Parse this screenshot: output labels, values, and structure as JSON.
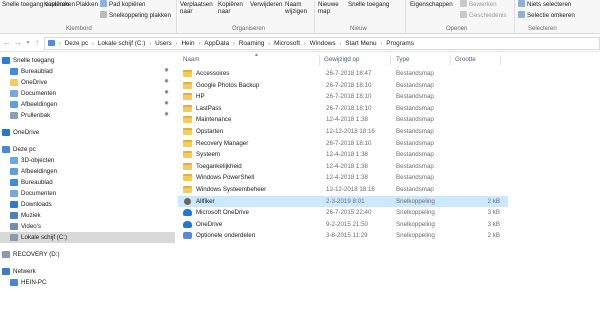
{
  "ribbon": {
    "copy_path": "Snelle toegang vastmaken",
    "copy": "Kopiëren",
    "paste": "Plakken",
    "cut": "Knippen",
    "copy_path_label": "Pad kopiëren",
    "paste_shortcut": "Snelkoppeling plakken",
    "move_to": "Verplaatsen naar",
    "copy_to": "Kopiëren naar",
    "delete": "Verwijderen",
    "rename": "Naam wijzigen",
    "new_folder": "Nieuwe map",
    "easy_access": "Snelle toegang",
    "properties": "Eigenschappen",
    "edit": "Bewerken",
    "history": "Geschiedenis",
    "select_none": "Niets selecteren",
    "invert_selection": "Selectie omkeren",
    "groups": {
      "clipboard": "Klembord",
      "organize": "Organiseren",
      "new": "Nieuw",
      "open": "Openen",
      "select": "Selecteren"
    }
  },
  "address": {
    "crumbs": [
      "Deze pc",
      "Lokale schijf (C:)",
      "Users",
      "Hein",
      "AppData",
      "Roaming",
      "Microsoft",
      "Windows",
      "Start Menu",
      "Programs"
    ]
  },
  "navpane": {
    "items": [
      {
        "label": "Snelle toegang",
        "icon": "star-icon",
        "pinned": false
      },
      {
        "label": "Bureaublad",
        "icon": "desktop-icon",
        "pinned": true
      },
      {
        "label": "OneDrive",
        "icon": "folder-icon",
        "pinned": true
      },
      {
        "label": "Documenten",
        "icon": "documents-icon",
        "pinned": true
      },
      {
        "label": "Afbeeldingen",
        "icon": "pictures-icon",
        "pinned": true
      },
      {
        "label": "Prullenbak",
        "icon": "recycle-bin-icon",
        "pinned": true
      },
      {
        "label": "OneDrive",
        "icon": "cloud-icon",
        "pinned": false
      },
      {
        "label": "Deze pc",
        "icon": "computer-icon",
        "pinned": false
      },
      {
        "label": "3D-objecten",
        "icon": "cube-icon",
        "pinned": false
      },
      {
        "label": "Afbeeldingen",
        "icon": "pictures-icon",
        "pinned": false
      },
      {
        "label": "Bureaublad",
        "icon": "desktop-icon",
        "pinned": false
      },
      {
        "label": "Documenten",
        "icon": "documents-icon",
        "pinned": false
      },
      {
        "label": "Downloads",
        "icon": "download-icon",
        "pinned": false
      },
      {
        "label": "Muziek",
        "icon": "music-icon",
        "pinned": false
      },
      {
        "label": "Video's",
        "icon": "video-icon",
        "pinned": false
      },
      {
        "label": "Lokale schijf (C:)",
        "icon": "drive-icon",
        "pinned": false
      },
      {
        "label": "RECOVERY (D:)",
        "icon": "drive-icon",
        "pinned": false
      },
      {
        "label": "Netwerk",
        "icon": "network-icon",
        "pinned": false
      },
      {
        "label": "HEIN-PC",
        "icon": "computer-icon",
        "pinned": false
      }
    ]
  },
  "columns": {
    "name": "Naam",
    "date": "Gewijzigd op",
    "type": "Type",
    "size": "Grootte"
  },
  "files": [
    {
      "name": "Accessoires",
      "date": "26-7-2018 18:47",
      "type": "Bestandsmap",
      "size": "",
      "kind": "folder"
    },
    {
      "name": "Google Photos Backup",
      "date": "26-7-2018 18:10",
      "type": "Bestandsmap",
      "size": "",
      "kind": "folder"
    },
    {
      "name": "HP",
      "date": "26-7-2018 18:10",
      "type": "Bestandsmap",
      "size": "",
      "kind": "folder"
    },
    {
      "name": "LastPass",
      "date": "26-7-2018 18:10",
      "type": "Bestandsmap",
      "size": "",
      "kind": "folder"
    },
    {
      "name": "Maintenance",
      "date": "12-4-2018 1:38",
      "type": "Bestandsmap",
      "size": "",
      "kind": "folder"
    },
    {
      "name": "Opstarten",
      "date": "12-12-2018 18:16",
      "type": "Bestandsmap",
      "size": "",
      "kind": "folder"
    },
    {
      "name": "Recovery Manager",
      "date": "26-7-2018 18:10",
      "type": "Bestandsmap",
      "size": "",
      "kind": "folder"
    },
    {
      "name": "Systeem",
      "date": "12-4-2018 1:38",
      "type": "Bestandsmap",
      "size": "",
      "kind": "folder"
    },
    {
      "name": "Toegankelijkheid",
      "date": "12-4-2018 1:38",
      "type": "Bestandsmap",
      "size": "",
      "kind": "folder"
    },
    {
      "name": "Windows PowerShell",
      "date": "12-4-2018 1:38",
      "type": "Bestandsmap",
      "size": "",
      "kind": "folder"
    },
    {
      "name": "Windows Systeembeheer",
      "date": "12-12-2018 18:16",
      "type": "Bestandsmap",
      "size": "",
      "kind": "folder"
    },
    {
      "name": "Allfiker",
      "date": "2-3-2019 8:01",
      "type": "Snelkoppeling",
      "size": "2 kB",
      "kind": "shortcut"
    },
    {
      "name": "Microsoft OneDrive",
      "date": "26-7-2015 22:40",
      "type": "Snelkoppeling",
      "size": "3 kB",
      "kind": "shortcut"
    },
    {
      "name": "OneDrive",
      "date": "9-2-2015 21:50",
      "type": "Snelkoppeling",
      "size": "3 kB",
      "kind": "shortcut"
    },
    {
      "name": "Optionele onderdelen",
      "date": "3-8-2015 11:29",
      "type": "Snelkoppeling",
      "size": "2 kB",
      "kind": "shortcut"
    }
  ]
}
